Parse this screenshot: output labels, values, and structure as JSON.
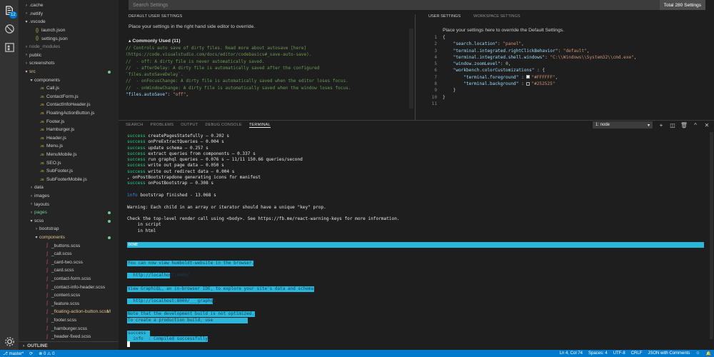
{
  "activity": {
    "badge": "12"
  },
  "explorer": {
    "items": [
      {
        "label": ".cache",
        "indent": 1,
        "kind": "folder-closed",
        "color": "#cccccc"
      },
      {
        "label": ".netlify",
        "indent": 1,
        "kind": "folder-closed",
        "color": "#cccccc"
      },
      {
        "label": ".vscode",
        "indent": 1,
        "kind": "folder-open",
        "color": "#cccccc"
      },
      {
        "label": "launch.json",
        "indent": 2,
        "kind": "json",
        "color": "#cccccc"
      },
      {
        "label": "settings.json",
        "indent": 2,
        "kind": "json",
        "color": "#cccccc"
      },
      {
        "label": "node_modules",
        "indent": 1,
        "kind": "folder-closed",
        "color": "#8c8c8c"
      },
      {
        "label": "public",
        "indent": 1,
        "kind": "folder-closed",
        "color": "#cccccc"
      },
      {
        "label": "screenshots",
        "indent": 1,
        "kind": "folder-closed",
        "color": "#cccccc"
      },
      {
        "label": "src",
        "indent": 1,
        "kind": "folder-open",
        "color": "#e2c08d",
        "marker": "dot"
      },
      {
        "label": "components",
        "indent": 2,
        "kind": "folder-open",
        "color": "#cccccc"
      },
      {
        "label": "Call.js",
        "indent": 3,
        "kind": "js",
        "color": "#cccccc"
      },
      {
        "label": "ContactForm.js",
        "indent": 3,
        "kind": "js",
        "color": "#cccccc"
      },
      {
        "label": "ContactInfoHeader.js",
        "indent": 3,
        "kind": "js",
        "color": "#cccccc"
      },
      {
        "label": "FloatingActionButton.js",
        "indent": 3,
        "kind": "js",
        "color": "#cccccc"
      },
      {
        "label": "Footer.js",
        "indent": 3,
        "kind": "js",
        "color": "#cccccc"
      },
      {
        "label": "Hamburger.js",
        "indent": 3,
        "kind": "js",
        "color": "#cccccc"
      },
      {
        "label": "Header.js",
        "indent": 3,
        "kind": "js",
        "color": "#cccccc"
      },
      {
        "label": "Menu.js",
        "indent": 3,
        "kind": "js",
        "color": "#cccccc"
      },
      {
        "label": "MenuMobile.js",
        "indent": 3,
        "kind": "js",
        "color": "#cccccc"
      },
      {
        "label": "SEO.js",
        "indent": 3,
        "kind": "js",
        "color": "#cccccc"
      },
      {
        "label": "SubFooter.js",
        "indent": 3,
        "kind": "js",
        "color": "#cccccc"
      },
      {
        "label": "SubFooterMobile.js",
        "indent": 3,
        "kind": "js",
        "color": "#cccccc"
      },
      {
        "label": "data",
        "indent": 2,
        "kind": "folder-closed",
        "color": "#cccccc"
      },
      {
        "label": "images",
        "indent": 2,
        "kind": "folder-closed",
        "color": "#cccccc"
      },
      {
        "label": "layouts",
        "indent": 2,
        "kind": "folder-closed",
        "color": "#cccccc"
      },
      {
        "label": "pages",
        "indent": 2,
        "kind": "folder-closed",
        "color": "#73c991",
        "marker": "dot"
      },
      {
        "label": "scss",
        "indent": 2,
        "kind": "folder-open",
        "color": "#cccccc",
        "marker": "dot"
      },
      {
        "label": "bootstrap",
        "indent": 3,
        "kind": "folder-closed",
        "color": "#cccccc"
      },
      {
        "label": "components",
        "indent": 3,
        "kind": "folder-open",
        "color": "#e2c08d",
        "marker": "dot"
      },
      {
        "label": "_buttons.scss",
        "indent": 4,
        "kind": "scss",
        "color": "#cccccc"
      },
      {
        "label": "_call.scss",
        "indent": 4,
        "kind": "scss",
        "color": "#cccccc"
      },
      {
        "label": "_card-two.scss",
        "indent": 4,
        "kind": "scss",
        "color": "#cccccc"
      },
      {
        "label": "_card.scss",
        "indent": 4,
        "kind": "scss",
        "color": "#cccccc"
      },
      {
        "label": "_contact-form.scss",
        "indent": 4,
        "kind": "scss",
        "color": "#cccccc"
      },
      {
        "label": "_contact-info-header.scss",
        "indent": 4,
        "kind": "scss",
        "color": "#cccccc"
      },
      {
        "label": "_content.scss",
        "indent": 4,
        "kind": "scss",
        "color": "#cccccc"
      },
      {
        "label": "_feature.scss",
        "indent": 4,
        "kind": "scss",
        "color": "#cccccc"
      },
      {
        "label": "_floating-action-button.scss",
        "indent": 4,
        "kind": "scss",
        "color": "#e2c08d",
        "marker": "M"
      },
      {
        "label": "_footer.scss",
        "indent": 4,
        "kind": "scss",
        "color": "#cccccc"
      },
      {
        "label": "_hamburger.scss",
        "indent": 4,
        "kind": "scss",
        "color": "#cccccc"
      },
      {
        "label": "_header-fixed.scss",
        "indent": 4,
        "kind": "scss",
        "color": "#cccccc"
      }
    ],
    "outline_label": "OUTLINE"
  },
  "settings": {
    "search_placeholder": "Search Settings",
    "total_label": "Total 280 Settings",
    "default_tab": "DEFAULT USER SETTINGS",
    "default_desc": "Place your settings in the right hand side editor to override.",
    "commonly_used": "Commonly Used (11)",
    "user_tab": "USER SETTINGS",
    "workspace_tab": "WORKSPACE SETTINGS",
    "user_desc": "Place your settings here to override the Default Settings.",
    "left_code": [
      [
        {
          "t": "// Controls auto save of dirty files. Read more about autosave [here]",
          "c": "c-com"
        }
      ],
      [
        {
          "t": "(https://code.visualstudio.com/docs/editor/codebasics#_save-auto-save).",
          "c": "c-com"
        }
      ],
      [
        {
          "t": "//  - off: A dirty file is never automatically saved.",
          "c": "c-com"
        }
      ],
      [
        {
          "t": "//  - afterDelay: A dirty file is automatically saved after the configured",
          "c": "c-com"
        }
      ],
      [
        {
          "t": "`files.autoSaveDelay`.",
          "c": "c-com"
        }
      ],
      [
        {
          "t": "//  - onFocusChange: A dirty file is automatically saved when the editor loses focus.",
          "c": "c-com"
        }
      ],
      [
        {
          "t": "//  - onWindowChange: A dirty file is automatically saved when the window loses focus.",
          "c": "c-com"
        }
      ],
      [
        {
          "t": "\"files.autoSave\"",
          "c": "c-key"
        },
        {
          "t": ": ",
          "c": "c-p"
        },
        {
          "t": "\"off\"",
          "c": "c-str"
        },
        {
          "t": ",",
          "c": "c-p"
        }
      ]
    ],
    "line_numbers": [
      "1",
      "2",
      "3",
      "4",
      "5",
      "6",
      "7",
      "8",
      "9",
      "10",
      "11"
    ],
    "right_code": [
      [
        {
          "t": "{",
          "c": "c-p"
        }
      ],
      [
        {
          "t": "    \"search.location\"",
          "c": "c-key"
        },
        {
          "t": ": ",
          "c": "c-p"
        },
        {
          "t": "\"panel\"",
          "c": "c-str"
        },
        {
          "t": ",",
          "c": "c-p"
        }
      ],
      [
        {
          "t": "    \"terminal.integrated.rightClickBehavior\"",
          "c": "c-key"
        },
        {
          "t": ": ",
          "c": "c-p"
        },
        {
          "t": "\"default\"",
          "c": "c-str"
        },
        {
          "t": ",",
          "c": "c-p"
        }
      ],
      [
        {
          "t": "    \"terminal.integrated.shell.windows\"",
          "c": "c-key"
        },
        {
          "t": ": ",
          "c": "c-p"
        },
        {
          "t": "\"C:\\\\Windows\\\\System32\\\\cmd.exe\"",
          "c": "c-str"
        },
        {
          "t": ",",
          "c": "c-p"
        }
      ],
      [
        {
          "t": "    \"window.zoomLevel\"",
          "c": "c-key"
        },
        {
          "t": ": ",
          "c": "c-p"
        },
        {
          "t": "0",
          "c": "c-num"
        },
        {
          "t": ",",
          "c": "c-p"
        }
      ],
      [
        {
          "t": "    \"workbench.colorCustomizations\"",
          "c": "c-key"
        },
        {
          "t": " : {",
          "c": "c-p"
        }
      ],
      [
        {
          "t": "        \"terminal.foreground\"",
          "c": "c-key"
        },
        {
          "t": " : ",
          "c": "c-p"
        },
        {
          "swatch": "#FFFFFF"
        },
        {
          "t": "\"#FFFFFF\"",
          "c": "c-str"
        },
        {
          "t": ",",
          "c": "c-p"
        }
      ],
      [
        {
          "t": "        \"terminal.background\"",
          "c": "c-key"
        },
        {
          "t": " : ",
          "c": "c-p"
        },
        {
          "swatch": "#252525"
        },
        {
          "t": "\"#252525\"",
          "c": "c-str"
        }
      ],
      [
        {
          "t": "    }",
          "c": "c-p"
        }
      ],
      [
        {
          "t": "}",
          "c": "c-p"
        }
      ],
      [
        {
          "t": "",
          "c": "c-p"
        }
      ]
    ]
  },
  "panel": {
    "tabs": [
      "SEARCH",
      "PROBLEMS",
      "OUTPUT",
      "DEBUG CONSOLE",
      "TERMINAL"
    ],
    "active_tab": "TERMINAL",
    "terminal_select": "1: node",
    "terminal_lines": [
      [
        {
          "t": "success",
          "c": "t-green"
        },
        {
          "t": " createPagesStatefully — 0.202 s"
        }
      ],
      [
        {
          "t": "success",
          "c": "t-green"
        },
        {
          "t": " onPreExtractQueries — 0.004 s"
        }
      ],
      [
        {
          "t": "success",
          "c": "t-green"
        },
        {
          "t": " update schema — 0.257 s"
        }
      ],
      [
        {
          "t": "success",
          "c": "t-green"
        },
        {
          "t": " extract queries from components — 0.337 s"
        }
      ],
      [
        {
          "t": "success",
          "c": "t-green"
        },
        {
          "t": " run graphql queries — 0.076 s — 11/11 150.66 queries/second"
        }
      ],
      [
        {
          "t": "success",
          "c": "t-green"
        },
        {
          "t": " write out page data — 0.050 s"
        }
      ],
      [
        {
          "t": "success",
          "c": "t-green"
        },
        {
          "t": " write out redirect data — 0.004 s"
        }
      ],
      [
        {
          "t": ", onPostBootstrapdone generating icons for manifest"
        }
      ],
      [
        {
          "t": "success",
          "c": "t-green"
        },
        {
          "t": " onPostBootstrap — 0.308 s"
        }
      ],
      [
        {
          "t": ""
        }
      ],
      [
        {
          "t": "info",
          "c": "t-blue"
        },
        {
          "t": " bootstrap finished - 13.068 s"
        }
      ],
      [
        {
          "t": ""
        }
      ],
      [
        {
          "t": "Warning: Each child in an array or iterator should have a unique \"key\" prop."
        }
      ],
      [
        {
          "t": ""
        }
      ],
      [
        {
          "t": "Check the top-level render call using <body>. See https://fb.me/react-warning-keys for more information."
        }
      ],
      [
        {
          "t": "    in script"
        }
      ],
      [
        {
          "t": "    in html"
        }
      ]
    ],
    "done_label": "DONE",
    "highlight_lines": [
      "You can now view humboldt-website in the browser.",
      "  http://localhost:8000/",
      "View GraphiQL, an in-browser IDE, to explore your site's data and schema",
      "  http://localhost:8000/___graphql",
      "Note that the development build is not optimized.",
      "To create a production build, use",
      "success",
      "  info  : Compiled successfully."
    ]
  },
  "status": {
    "branch": "master*",
    "errors": "0",
    "warnings": "0",
    "position": "Ln 4, Col 74",
    "spaces": "Spaces: 4",
    "encoding": "UTF-8",
    "eol": "CRLF",
    "language": "JSON with Comments"
  },
  "colors": {
    "accent": "#007acc",
    "terminal_highlight": "#29b8db",
    "success_green": "#23d18b"
  }
}
